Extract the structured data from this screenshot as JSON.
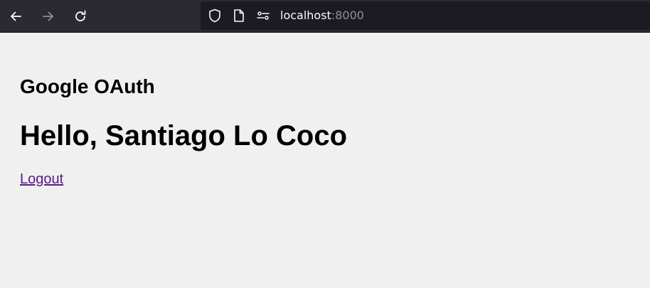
{
  "browser": {
    "url_host": "localhost",
    "url_port": ":8000",
    "icons": {
      "back": "back-arrow-icon",
      "forward": "forward-arrow-icon",
      "reload": "reload-icon",
      "tracking": "shield-icon",
      "page": "page-icon",
      "permissions": "permissions-icon"
    }
  },
  "page": {
    "app_title": "Google OAuth",
    "greeting": "Hello, Santiago Lo Coco",
    "logout_label": "Logout"
  },
  "colors": {
    "toolbar_bg": "#2b2a33",
    "urlbar_bg": "#1c1b22",
    "page_bg": "#f0f0f0",
    "visited_link": "#551a8b"
  }
}
